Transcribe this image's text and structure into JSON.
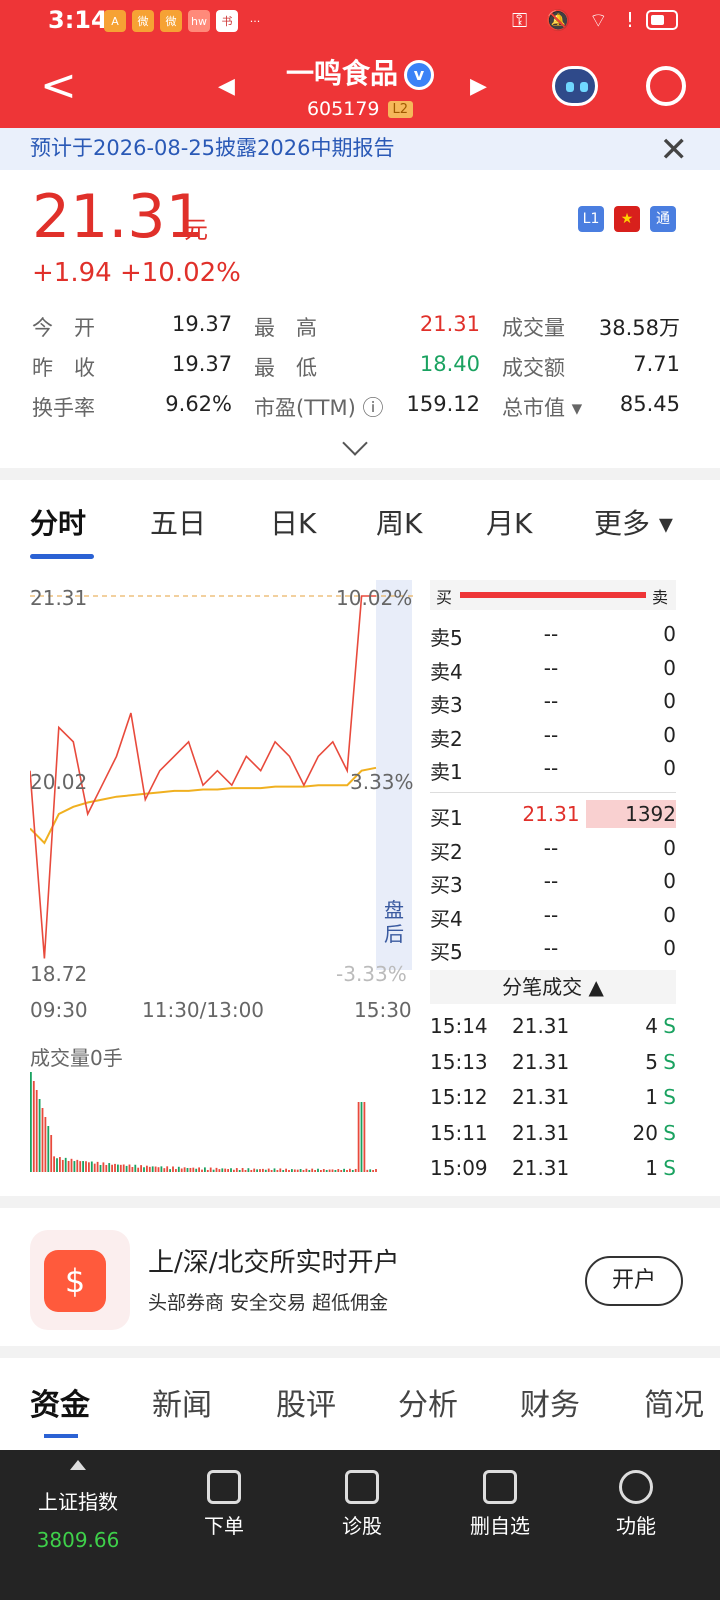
{
  "status": {
    "time": "3:14",
    "icons": [
      "A",
      "微",
      "微",
      "hw",
      "书",
      "···"
    ],
    "right": "⚿ 🔕 ⌔ ! "
  },
  "header": {
    "name": "一鸣食品",
    "verify": "v",
    "code": "605179",
    "level": "L2",
    "back": "<"
  },
  "notice": {
    "text": "预计于2026-08-25披露2026中期报告",
    "close": "✕"
  },
  "quote": {
    "price": "21.31",
    "unit": "元",
    "change": "+1.94",
    "pct": "+10.02%",
    "badges": [
      "L1",
      "★",
      "通"
    ],
    "rows": [
      {
        "l1": "今　开",
        "v1": "19.37",
        "l2": "最　高",
        "v2": "21.31",
        "l3": "成交量",
        "v3": "38.58万"
      },
      {
        "l1": "昨　收",
        "v1": "19.37",
        "l2": "最　低",
        "v2": "18.40",
        "l3": "成交额",
        "v3": "7.71"
      },
      {
        "l1": "换手率",
        "v1": "9.62%",
        "l2": "市盈(TTM) ⓘ",
        "v2": "159.12",
        "l3": "总市值 ▾",
        "v3": "85.45"
      }
    ]
  },
  "tabs": [
    "分时",
    "五日",
    "日K",
    "周K",
    "月K",
    "更多 ▾"
  ],
  "chart": {
    "top": "21.31",
    "top_pct": "10.02%",
    "mid": "20.02",
    "mid_pct": "3.33%",
    "low": "18.72",
    "low_pct": "-3.33%",
    "x": [
      "09:30",
      "11:30/13:00",
      "15:30"
    ],
    "after_hours": "盘后",
    "volume": "成交量0手",
    "accent": "#e84a3c",
    "avg": "#f0b020"
  },
  "chart_data": {
    "type": "line",
    "categories": [
      "09:30",
      "11:30/13:00",
      "15:30"
    ],
    "ylim": [
      18.72,
      21.31
    ],
    "series": [
      {
        "values": [
          20.1,
          18.8,
          20.4,
          20.3,
          19.8,
          20.0,
          20.2,
          20.5,
          19.9,
          20.1,
          20.2,
          20.3,
          20.0,
          20.1,
          20.0,
          20.2,
          20.1,
          20.3,
          20.2,
          20.0,
          20.2,
          20.3,
          20.1,
          21.31,
          21.31
        ]
      },
      {
        "values": [
          19.7,
          19.6,
          19.8,
          19.85,
          19.88,
          19.9,
          19.92,
          19.93,
          19.94,
          19.95,
          19.96,
          19.96,
          19.97,
          19.97,
          19.98,
          19.98,
          19.98,
          19.99,
          19.99,
          19.99,
          20.0,
          20.0,
          20.0,
          20.1,
          20.12
        ]
      }
    ]
  },
  "orderbook": {
    "header_buy": "买",
    "header_sell": "卖",
    "sells": [
      {
        "l": "卖5",
        "p": "--",
        "v": "0"
      },
      {
        "l": "卖4",
        "p": "--",
        "v": "0"
      },
      {
        "l": "卖3",
        "p": "--",
        "v": "0"
      },
      {
        "l": "卖2",
        "p": "--",
        "v": "0"
      },
      {
        "l": "卖1",
        "p": "--",
        "v": "0"
      }
    ],
    "buys": [
      {
        "l": "买1",
        "p": "21.31",
        "v": "1392"
      },
      {
        "l": "买2",
        "p": "--",
        "v": "0"
      },
      {
        "l": "买3",
        "p": "--",
        "v": "0"
      },
      {
        "l": "买4",
        "p": "--",
        "v": "0"
      },
      {
        "l": "买5",
        "p": "--",
        "v": "0"
      }
    ],
    "trades_title": "分笔成交 ▲",
    "trades": [
      {
        "t": "15:14",
        "p": "21.31",
        "v": "4"
      },
      {
        "t": "15:13",
        "p": "21.31",
        "v": "5"
      },
      {
        "t": "15:12",
        "p": "21.31",
        "v": "1"
      },
      {
        "t": "15:11",
        "p": "21.31",
        "v": "20"
      },
      {
        "t": "15:09",
        "p": "21.31",
        "v": "1"
      }
    ],
    "side": "S"
  },
  "promo": {
    "title": "上/深/北交所实时开户",
    "sub": "头部券商  安全交易  超低佣金",
    "btn": "开户",
    "icon": "$"
  },
  "bottom_tabs": [
    "资金",
    "新闻",
    "股评",
    "分析",
    "财务",
    "简况"
  ],
  "nav": {
    "index_label": "上证指数",
    "index_value": "3809.66",
    "items": [
      "下单",
      "诊股",
      "删自选",
      "功能"
    ]
  }
}
